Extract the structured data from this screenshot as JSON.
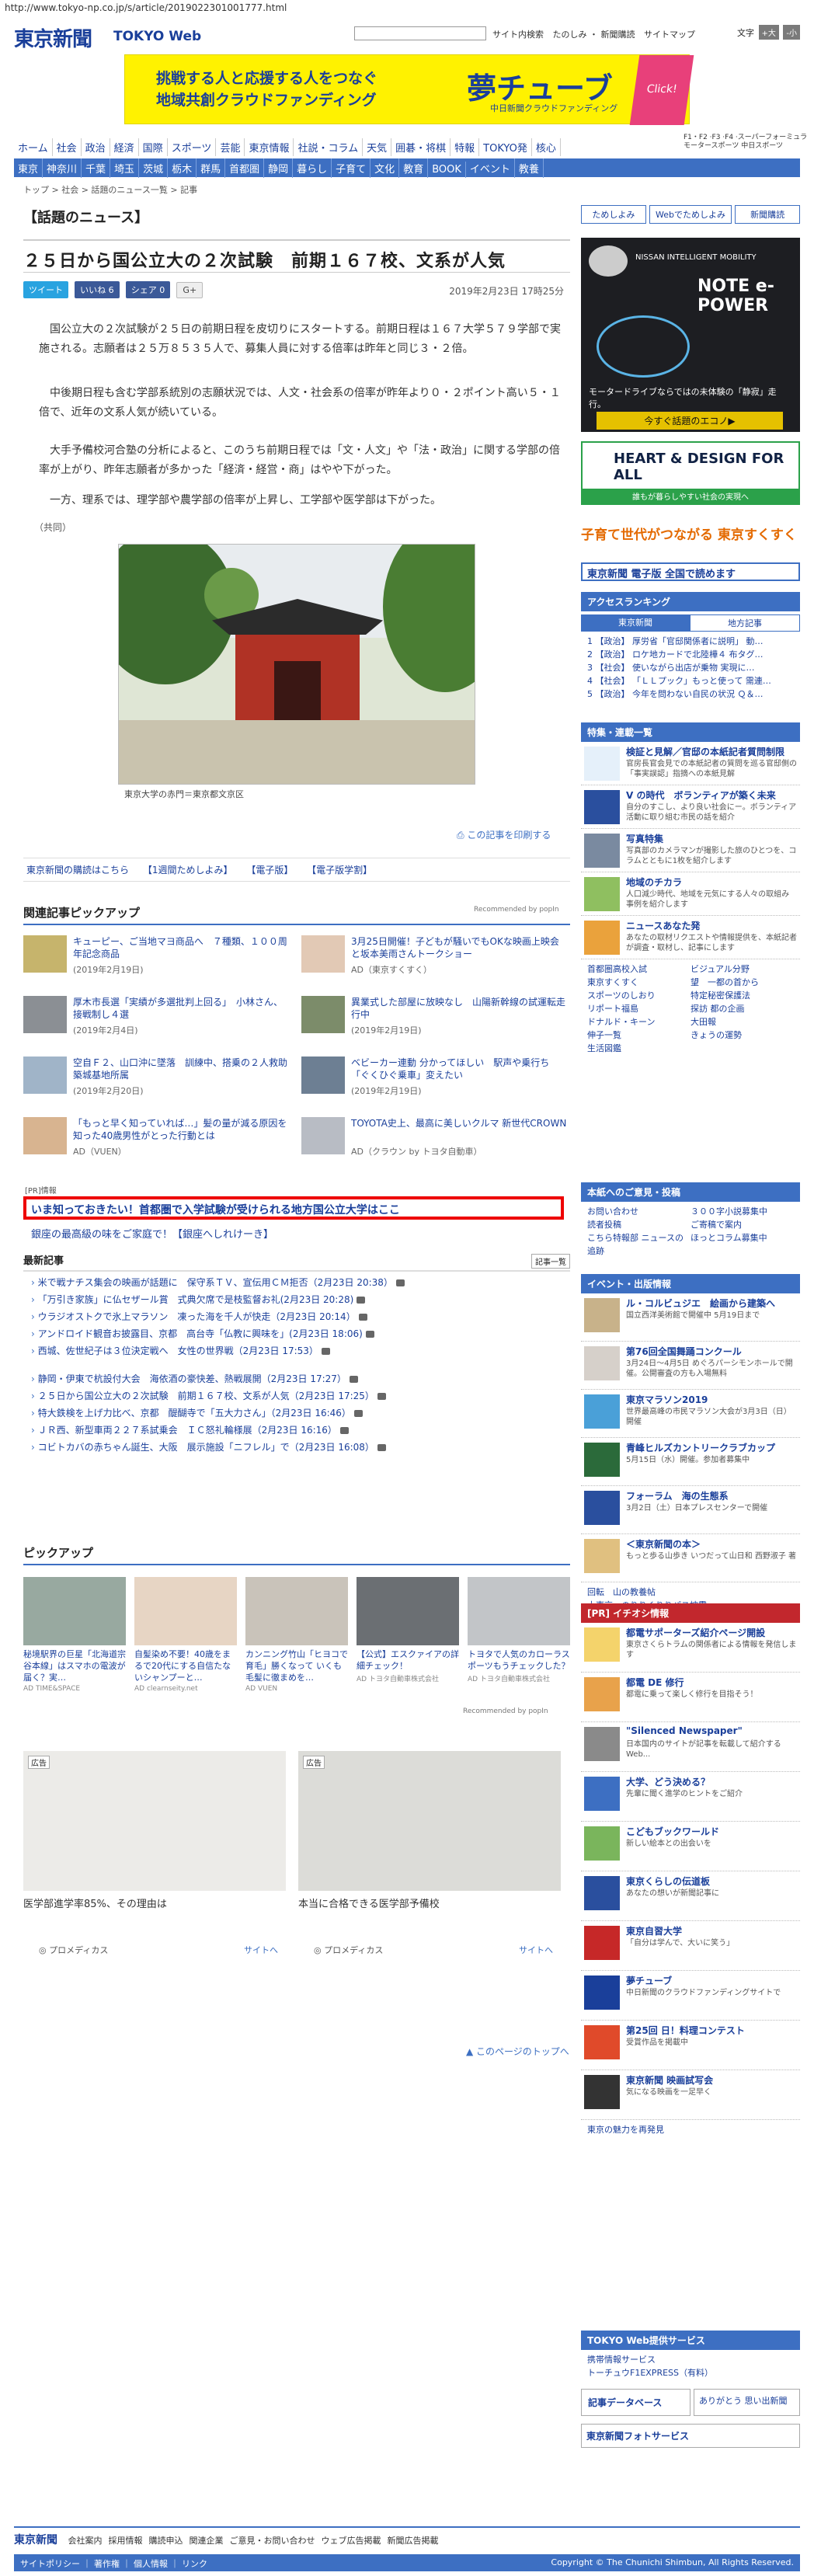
{
  "url": "http://www.tokyo-np.co.jp/s/article/2019022301001777.html",
  "header": {
    "logo": "東京新聞",
    "logo_sub": "TOKYO Web",
    "links": [
      "サイト内検索",
      "たのしみ ・ 新聞購読",
      "サイトマップ"
    ],
    "font_size_label": "文字",
    "font_buttons": [
      "+大",
      "-小"
    ]
  },
  "banner": {
    "line1": "挑戦する人と応援する人をつなぐ",
    "line2": "地域共創クラウドファンディング",
    "brand": "夢チューブ",
    "brand_sub": "中日新聞クラウドファンディング",
    "click": "Click!"
  },
  "nav1": [
    "ホーム",
    "社会",
    "政治",
    "経済",
    "国際",
    "スポーツ",
    "芸能",
    "東京情報",
    "社説・コラム",
    "天気",
    "囲碁・将棋",
    "特報",
    "TOKYO発",
    "核心"
  ],
  "nav_ad": "F1・F2 ·F3 ·F4 ·スーパーフォーミュラ\nモータースポーツ 中日スポーツ",
  "nav2": [
    "東京",
    "神奈川",
    "千葉",
    "埼玉",
    "茨城",
    "栃木",
    "群馬",
    "首都圏",
    "静岡",
    "暮らし",
    "子育て",
    "文化",
    "教育",
    "BOOK",
    "イベント",
    "教養"
  ],
  "breadcrumb": "トップ > 社会 > 話題のニュース一覧 > 記事",
  "section_title": "【話題のニュース】",
  "article": {
    "title": "２５日から国公立大の２次試験　前期１６７校、文系が人気",
    "date": "2019年2月23日 17時25分",
    "share": [
      "ツイート",
      "いいね 6",
      "シェア 0",
      "G+"
    ],
    "p1": "国公立大の２次試験が２５日の前期日程を皮切りにスタートする。前期日程は１６７大学５７９学部で実施される。志願者は２５万８５３５人で、募集人員に対する倍率は昨年と同じ３・２倍。",
    "p2": "中後期日程も含む学部系統別の志願状況では、人文・社会系の倍率が昨年より０・２ポイント高い５・１倍で、近年の文系人気が続いている。",
    "p3": "大手予備校河合塾の分析によると、このうち前期日程では「文・人文」や「法・政治」に関する学部の倍率が上がり、昨年志願者が多かった「経済・経営・商」はやや下がった。",
    "p4": "一方、理系では、理学部や農学部の倍率が上昇し、工学部や医学部は下がった。",
    "credit": "（共同）",
    "photo_caption": "東京大学の赤門＝東京都文京区",
    "print_link": "この記事を印刷する"
  },
  "aux_links": [
    "東京新聞の購読はこちら",
    "【1週間ためしよみ】",
    "【電子版】",
    "【電子版学割】"
  ],
  "related": {
    "title": "関連記事ピックアップ",
    "powered": "Recommended by popIn",
    "items": [
      {
        "title": "キューピー、ご当地マヨ商品へ　７種類、１００周年記念商品",
        "date": "(2019年2月19日)"
      },
      {
        "title": "3月25日開催！子どもが騒いでもOKな映画上映会と坂本美雨さんトークショー",
        "date": "AD（東京すくすく）"
      },
      {
        "title": "厚木市長選「実績が多選批判上回る」　小林さん、接戦制し４選",
        "date": "(2019年2月4日)"
      },
      {
        "title": "異業式した部屋に放映なし　山陽新幹線の試運転走行中",
        "date": "(2019年2月19日)"
      },
      {
        "title": "空自Ｆ２、山口沖に墜落　訓練中、搭乗の２人救助　築城基地所属",
        "date": "(2019年2月20日)"
      },
      {
        "title": "ベビーカー連動 分かってほしい　駅声や乗行ち「ぐくひぐ乗車」変えたい",
        "date": "(2019年2月19日)"
      },
      {
        "title": "「もっと早く知っていれば…」髪の量が減る原因を知った40歳男性がとった行動とは",
        "date": "AD（VUEN）"
      },
      {
        "title": "TOYOTA史上、最高に美しいクルマ 新世代CROWN",
        "date": "AD（クラウン by トヨタ自動車）"
      }
    ]
  },
  "pr": {
    "label": "[PR]情報",
    "main": "いま知っておきたい！首都圏で入学試験が受けられる地方国公立大学はここ",
    "second": "銀座の最高級の味をご家庭で！【銀座へしれけーき】"
  },
  "latest": {
    "title": "最新記事",
    "more": "記事一覧",
    "items": [
      "米で戦ナチス集会の映画が話題に　保守系ＴＶ、宣伝用ＣＭ拒否（2月23日 20:38）",
      "「万引き家族」に仏セザール賞　式典欠席で是枝監督お礼(2月23日 20:28)",
      "ウラジオストクで氷上マラソン　凍った海を千人が快走（2月23日 20:14）",
      "アンドロイド観音お披露目、京都　高台寺「仏教に興味を」(2月23日 18:06)",
      "西城、佐世紀子は３位決定戦へ　女性の世界戦（2月23日 17:53）",
      "静岡・伊東で杭設付大会　海依酒の豪快差、熱戦展開（2月23日 17:27）",
      "２５日から国公立大の２次試験　前期１６７校、文系が人気（2月23日 17:25）",
      "特大鉄検を上げ力比べ、京都　醍醐寺で「五大力さん」（2月23日 16:46）",
      "ＪＲ西、新型車両２２７系試乗会　ＩＣ怒礼輪様展（2月23日 16:16）",
      "コビトカバの赤ちゃん誕生、大阪　展示施設「ニフレル」で（2月23日 16:08）"
    ]
  },
  "pickup": {
    "title": "ピックアップ",
    "items": [
      {
        "title": "秘境駅界の巨星「北海道宗谷本線」はスマホの電波が届く？実…",
        "src": "AD  TIME&SPACE"
      },
      {
        "title": "自髪染め不要！40歳をまるで20代にする自信たないシャンプーと…",
        "src": "AD clearnseity.net"
      },
      {
        "title": "カンニング竹山「ヒヨコで育毛」勝くなって いくも毛髪に徹まめを…",
        "src": "AD VUEN"
      },
      {
        "title": "【公式】エスクァイアの詳細チェック！",
        "src": "AD トヨタ自動車株式会社"
      },
      {
        "title": "トヨタで人気のカローラスポーツもうチェックした？",
        "src": "AD トヨタ自動車株式会社"
      }
    ],
    "powered": "Recommended by popIn"
  },
  "ads": [
    {
      "tag": "広告",
      "title": "医学部進学率85%、その理由は",
      "src": "プロメディカス",
      "go": "サイトへ"
    },
    {
      "tag": "広告",
      "title": "本当に合格できる医学部予備校",
      "src": "プロメディカス",
      "go": "サイトへ"
    }
  ],
  "page_top": "このページのトップへ",
  "right": {
    "top_links": [
      "ためしよみ",
      "Webでためしよみ",
      "新聞購読"
    ],
    "nissan_ad": "NISSAN INTELLIGENT MOBILITY",
    "nissan_note": "NOTE e-POWER",
    "nissan_sub": "モータードライブならではの未体験の「静寂」走行。",
    "nissan_btn": "今すぐ話題のエコノ▶",
    "heart": "HEART & DESIGN FOR ALL",
    "heart_sub": "誰もが暮らしやすい社会の実現へ",
    "sukusuku": "子育て世代がつながる 東京すくすく",
    "digital": "東京新聞 電子版 全国で読めます",
    "ranking_title": "アクセスランキング",
    "ranking_tabs": [
      "東京新聞",
      "地方記事"
    ],
    "ranking": [
      "1 【政治】 厚労省「官邸関係者に説明」 動…",
      "2 【政治】 ロケ地カードで北陸樺４ 布タグ…",
      "3 【社会】 使いながら出店が乗物 実現に…",
      "4 【社会】 「ＬＬプック」もっと使って 需連…",
      "5 【政治】 今年を問わない自民の状況 Ｑ＆…"
    ],
    "tokushu_title": "特集・連載一覧",
    "features": [
      {
        "t": "検証と見解／官邸の本紙記者質問制限",
        "d": "官房長官会見での本紙記者の質問を巡る官邸側の「事実誤認」指摘への本紙見解"
      },
      {
        "t": "V の時代　ボランティアが築く未来",
        "d": "自分のすこし、より良い社会にー。ボランティア活動に取り組む市民の話を紹介"
      },
      {
        "t": "写真特集",
        "d": "写真部のカメラマンが撮影した旅のひとつを、コラムとともに1枚を紹介します"
      },
      {
        "t": "地域のチカラ",
        "d": "人口減少時代、地域を元気にする人々の取組み事例を紹介します"
      },
      {
        "t": "ニュースあなた発",
        "d": "あなたの取材リクエストや情報提供を、本紙記者が調査・取材し、記事にします"
      }
    ],
    "links_grid": [
      "首都圏高校入試",
      "ビジュアル分野",
      "東京すくすく",
      "望　一都の首から",
      "スポーツのしおり",
      "特定秘密保護法",
      "リポート福島",
      "探訪 都の企画",
      "ドナルド・キーン",
      "大田報",
      "伸子一覧",
      "きょうの運勢",
      "生活図鑑"
    ],
    "opinion_title": "本紙へのご意見・投稿",
    "opinion": [
      "お問い合わせ",
      "３００字小説募集中",
      "読者投稿",
      "ご寄稿で案内",
      "こちら特報部 ニュースの追跡",
      "ほっとコラム募集中"
    ],
    "event_title": "イベント・出版情報",
    "events": [
      {
        "t": "ル・コルビュジエ　絵画から建築へ",
        "d": "国立西洋美術館で開催中 5月19日まで"
      },
      {
        "t": "第76回全国舞踊コンクール",
        "d": "3月24日〜4月5日 めぐろパーシモンホールで開催。公開審査の方も入場無料"
      },
      {
        "t": "東京マラソン2019",
        "d": "世界最高峰の市民マラソン大会が3月3日（日）開催"
      },
      {
        "t": "青峰ヒルズカントリークラブカップ",
        "d": "5月15日（水）開催。参加者募集中"
      },
      {
        "t": "フォーラム　海の生態系",
        "d": "3月2日（土）日本プレスセンターで開催"
      },
      {
        "t": "＜東京新聞の本＞",
        "d": "もっと歩る山歩き いつだって山日和 西野淑子 著"
      }
    ],
    "event_links": [
      "回転　山の教養帖",
      "大東京　のりりくりりパス披露"
    ],
    "pr_title": "[PR] イチオシ情報",
    "pr_items": [
      {
        "t": "都電サポーターズ紹介ページ開設",
        "d": "東京さくらトラムの関係者による情報を発信します"
      },
      {
        "t": "都電 DE 修行",
        "d": "都電に乗って楽しく修行を目指そう！"
      },
      {
        "t": "\"Silenced Newspaper\"",
        "d": "日本国内のサイトが記事を転載して紹介するWeb..."
      },
      {
        "t": "大学、どう決める？",
        "d": "先輩に聞く進学のヒントをご紹介"
      },
      {
        "t": "こどもブックワールド",
        "d": "新しい絵本との出会いを"
      },
      {
        "t": "東京くらしの伝道板",
        "d": "あなたの想いが新聞記事に"
      },
      {
        "t": "東京自習大学",
        "d": "「自分は学んで、大いに笑う」"
      },
      {
        "t": "夢チューブ",
        "d": "中日新聞のクラウドファンディングサイトで"
      },
      {
        "t": "第25回 日！料理コンテスト",
        "d": "受賞作品を掲載中"
      },
      {
        "t": "東京新聞 映画試写会",
        "d": "気になる映画を一足早く"
      }
    ],
    "pr_more": "東京の魅力を再発見",
    "tokyoweb_title": "TOKYO Web提供サービス",
    "tokyoweb": [
      "携帯情報サービス",
      "トーチュウF1EXPRESS（有料）"
    ],
    "bottom_btns": [
      "記事データベース",
      "ありがとう 思い出新聞"
    ],
    "photo_service": "東京新聞フォトサービス"
  },
  "footer": {
    "logo": "東京新聞",
    "links": [
      "会社案内",
      "採用情報",
      "購読申込",
      "関連企業",
      "ご意見・お問い合わせ",
      "ウェブ広告掲載",
      "新聞広告掲載"
    ],
    "bottom_links": "サイトポリシー ｜ 著作権 ｜ 個人情報 ｜ リンク",
    "copyright": "Copyright © The Chunichi Shimbun, All Rights Reserved."
  },
  "colors": {
    "brand": "#1a3f9a",
    "nav": "#3d6fc2",
    "pr_box": "#ee0000"
  }
}
